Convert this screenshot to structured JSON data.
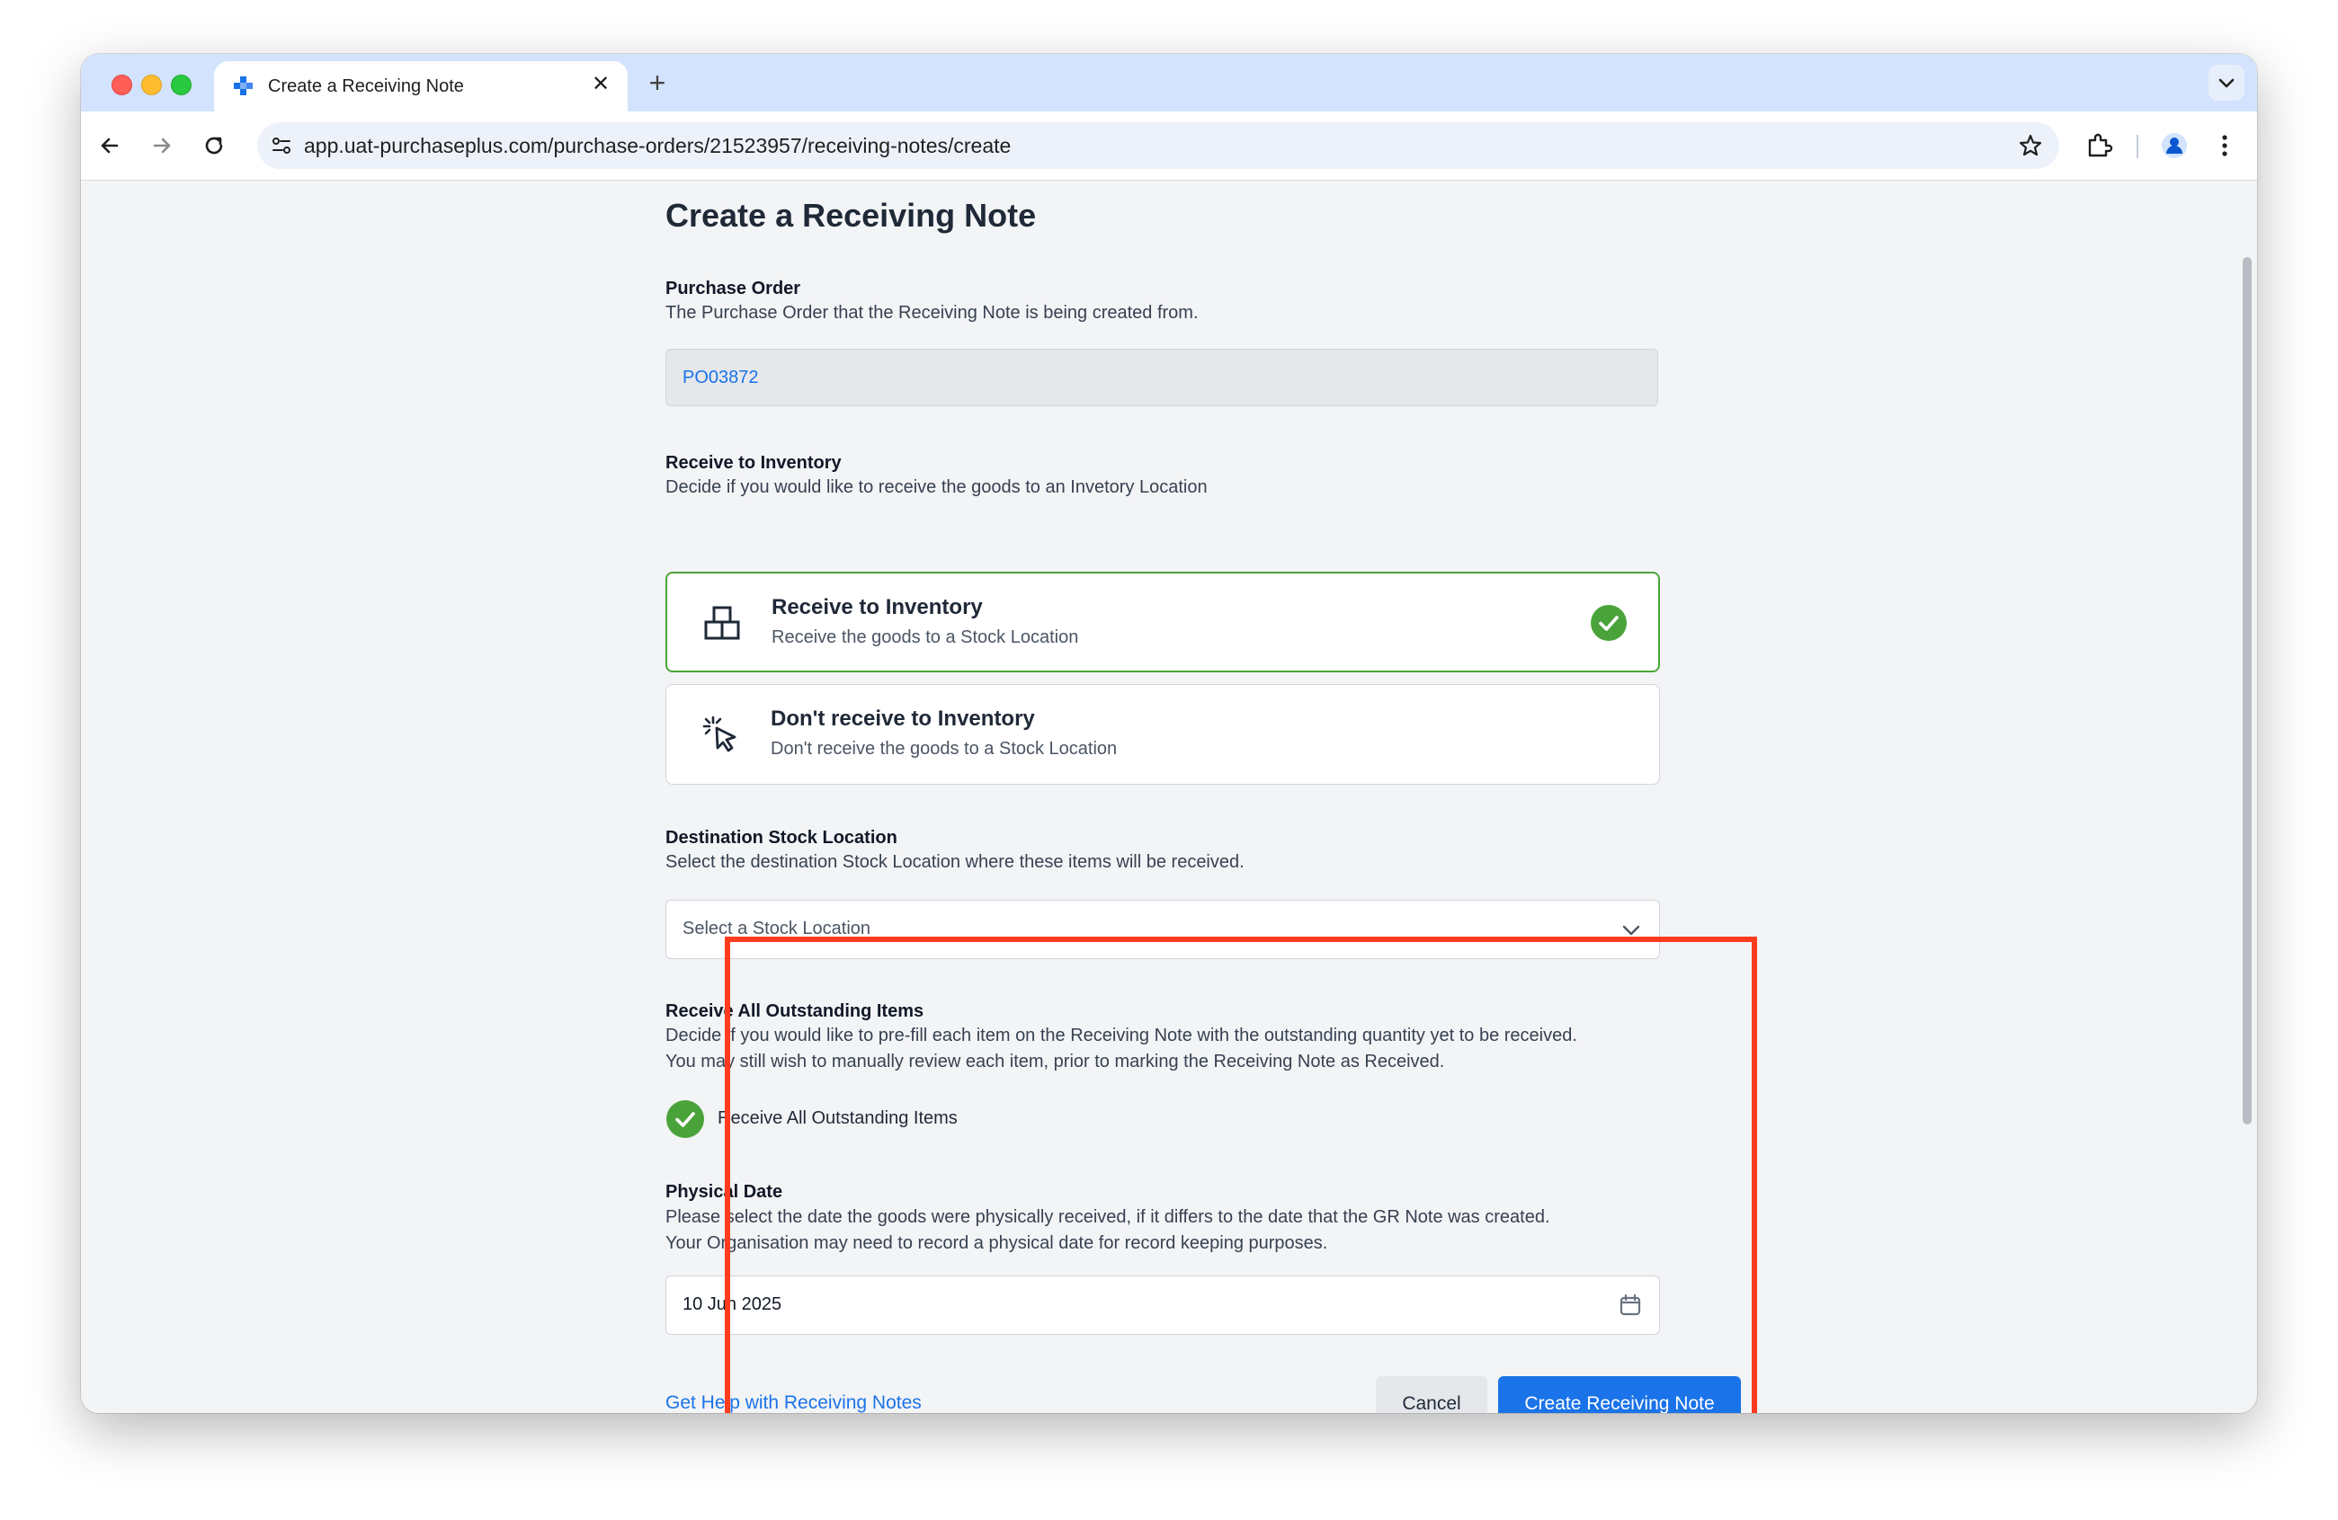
{
  "browser": {
    "tab_title": "Create a Receiving Note",
    "url": "app.uat-purchaseplus.com/purchase-orders/21523957/receiving-notes/create",
    "new_tab_symbol": "+",
    "close_symbol": "✕"
  },
  "page": {
    "title": "Create a Receiving Note"
  },
  "purchase_order": {
    "label": "Purchase Order",
    "description": "The Purchase Order that the Receiving Note is being created from.",
    "value": "PO03872"
  },
  "receive_to_inventory": {
    "label": "Receive to Inventory",
    "description": "Decide if you would like to receive the goods to an Invetory Location",
    "options": [
      {
        "title": "Receive to Inventory",
        "description": "Receive the goods to a Stock Location",
        "icon": "boxes-icon",
        "selected": true
      },
      {
        "title": "Don't receive to Inventory",
        "description": "Don't receive the goods to a Stock Location",
        "icon": "cursor-click-icon",
        "selected": false
      }
    ]
  },
  "destination_stock_location": {
    "label": "Destination Stock Location",
    "description": "Select the destination Stock Location where these items will be received.",
    "placeholder": "Select a Stock Location"
  },
  "receive_all_outstanding": {
    "label": "Receive All Outstanding Items",
    "description_line1": "Decide if you would like to pre-fill each item on the Receiving Note with the outstanding quantity yet to be received.",
    "description_line2": "You may still wish to manually review each item, prior to marking the Receiving Note as Received.",
    "checkbox_label": "Receive All Outstanding Items",
    "checked": true
  },
  "physical_date": {
    "label": "Physical Date",
    "description_line1": "Please select the date the goods were physically received, if it differs to the date that the GR Note was created.",
    "description_line2": "Your Organisation may need to record a physical date for record keeping purposes.",
    "value": "10 Jun 2025"
  },
  "footer": {
    "help_link": "Get Help with Receiving Notes",
    "cancel_label": "Cancel",
    "submit_label": "Create Receiving Note"
  },
  "colors": {
    "accent_blue": "#1a73e8",
    "success_green": "#4aa33a",
    "highlight_red": "#ff3b1f"
  }
}
